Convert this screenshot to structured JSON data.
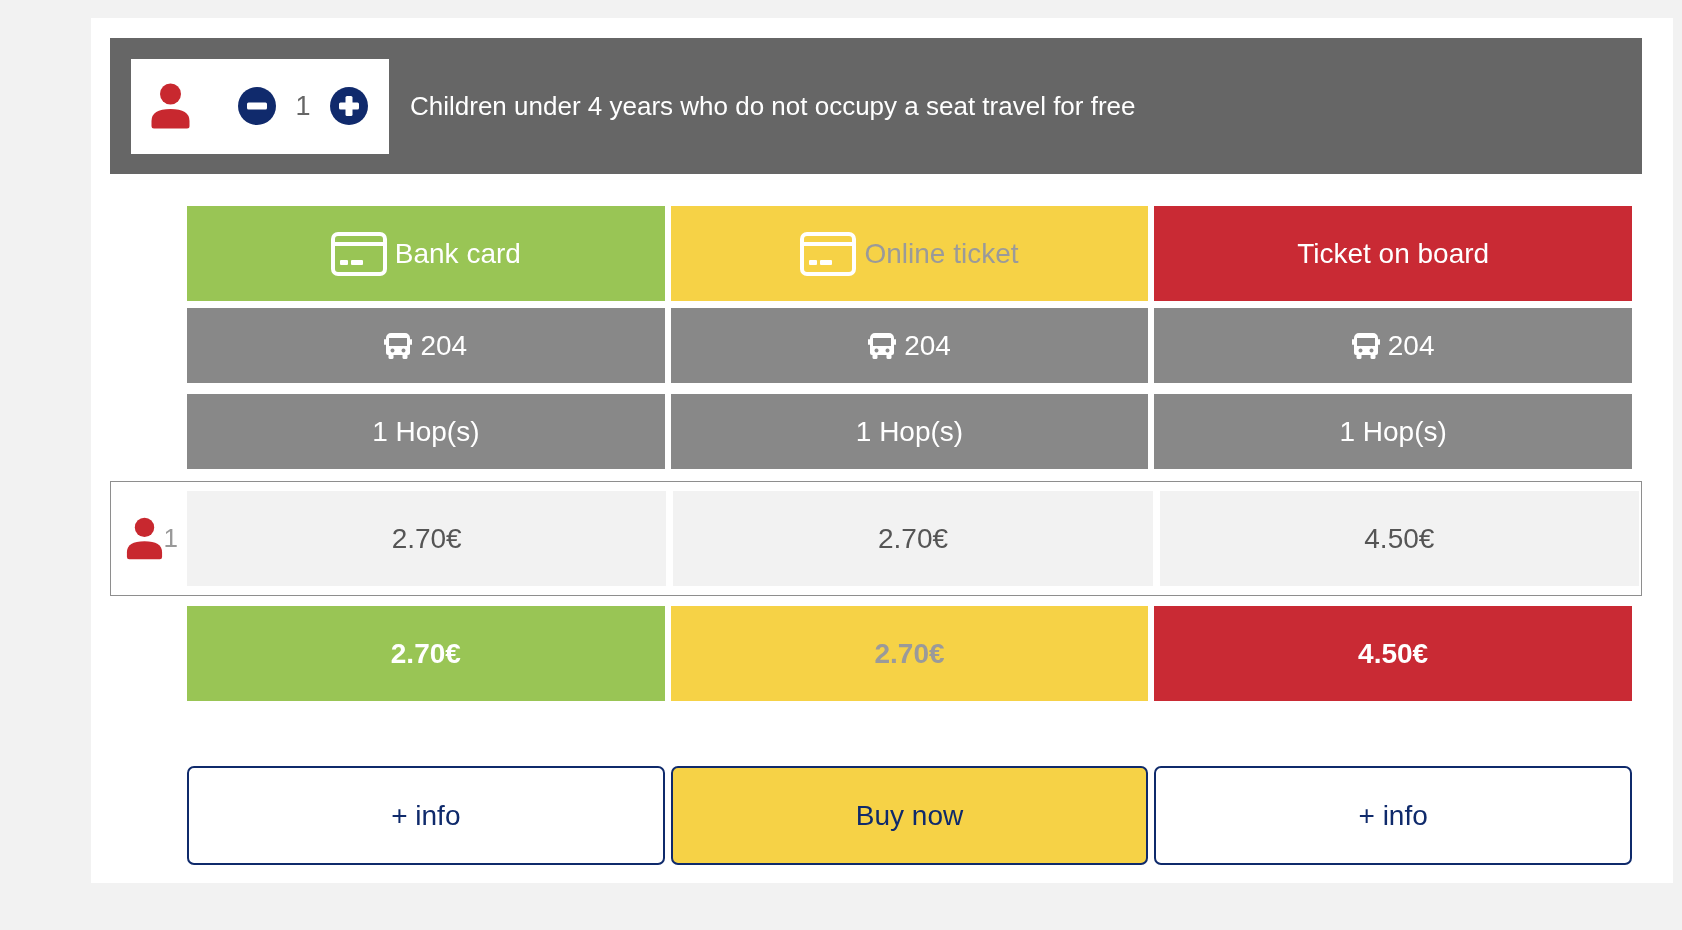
{
  "passenger_bar": {
    "count": "1",
    "note": "Children under 4 years who do not occupy a seat travel for free"
  },
  "fares": [
    {
      "label": "Bank card",
      "kind": "card",
      "color": "#99c555",
      "line": "204",
      "hops": "1 Hop(s)"
    },
    {
      "label": "Online ticket",
      "kind": "card",
      "color": "#f6d246",
      "line": "204",
      "hops": "1 Hop(s)"
    },
    {
      "label": "Ticket on board",
      "kind": "plain",
      "color": "#c92a34",
      "line": "204",
      "hops": "1 Hop(s)"
    }
  ],
  "passenger_rows": [
    {
      "count": "1",
      "prices": [
        "2.70€",
        "2.70€",
        "4.50€"
      ]
    }
  ],
  "totals": [
    "2.70€",
    "2.70€",
    "4.50€"
  ],
  "actions": [
    {
      "label": "+ info",
      "kind": "outline"
    },
    {
      "label": "Buy now",
      "kind": "primary"
    },
    {
      "label": "+ info",
      "kind": "outline"
    }
  ]
}
